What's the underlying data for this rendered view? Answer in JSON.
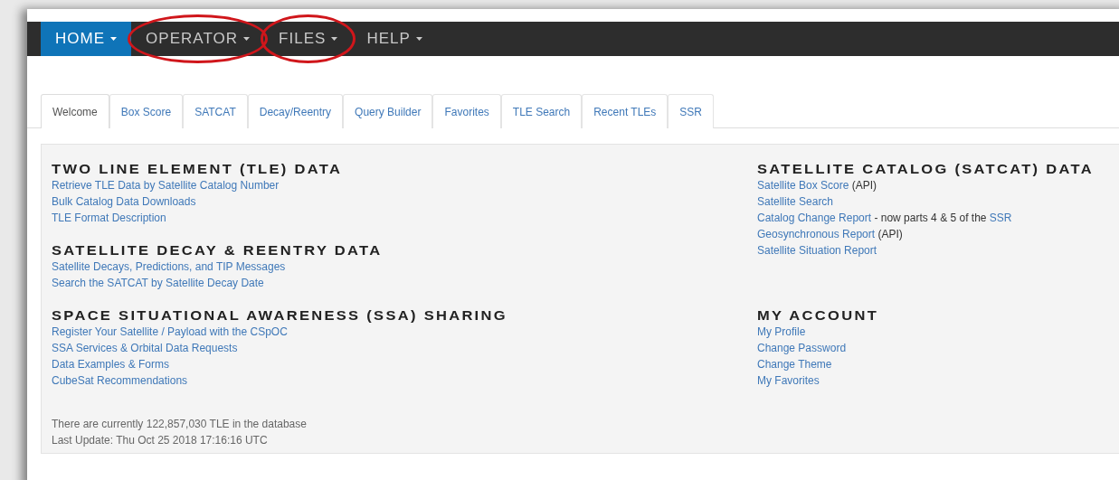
{
  "navbar": [
    {
      "label": "HOME",
      "selected": true,
      "circled": false
    },
    {
      "label": "OPERATOR",
      "selected": false,
      "circled": true
    },
    {
      "label": "FILES",
      "selected": false,
      "circled": true
    },
    {
      "label": "HELP",
      "selected": false,
      "circled": false
    }
  ],
  "tabs": [
    {
      "label": "Welcome",
      "selected": true
    },
    {
      "label": "Box Score",
      "selected": false
    },
    {
      "label": "SATCAT",
      "selected": false
    },
    {
      "label": "Decay/Reentry",
      "selected": false
    },
    {
      "label": "Query Builder",
      "selected": false
    },
    {
      "label": "Favorites",
      "selected": false
    },
    {
      "label": "TLE Search",
      "selected": false
    },
    {
      "label": "Recent TLEs",
      "selected": false
    },
    {
      "label": "SSR",
      "selected": false
    }
  ],
  "left_sections": [
    {
      "title": "TWO LINE ELEMENT (TLE) DATA",
      "lines": [
        [
          {
            "text": "Retrieve TLE Data by Satellite Catalog Number",
            "link": true
          }
        ],
        [
          {
            "text": "Bulk Catalog Data Downloads",
            "link": true
          }
        ],
        [
          {
            "text": "TLE Format Description",
            "link": true
          }
        ]
      ]
    },
    {
      "title": "SATELLITE DECAY & REENTRY DATA",
      "lines": [
        [
          {
            "text": "Satellite Decays, Predictions, and TIP Messages",
            "link": true
          }
        ],
        [
          {
            "text": "Search the SATCAT by Satellite Decay Date",
            "link": true
          }
        ]
      ]
    },
    {
      "title": "SPACE SITUATIONAL AWARENESS (SSA) SHARING",
      "lines": [
        [
          {
            "text": "Register Your Satellite / Payload with the CSpOC",
            "link": true
          }
        ],
        [
          {
            "text": "SSA Services & Orbital Data Requests",
            "link": true
          }
        ],
        [
          {
            "text": "Data Examples & Forms",
            "link": true
          }
        ],
        [
          {
            "text": "CubeSat Recommendations",
            "link": true
          }
        ]
      ]
    }
  ],
  "right_sections": [
    {
      "title": "SATELLITE CATALOG (SATCAT) DATA",
      "lines": [
        [
          {
            "text": "Satellite Box Score",
            "link": true
          },
          {
            "text": " (API)",
            "link": false
          }
        ],
        [
          {
            "text": "Satellite Search",
            "link": true
          }
        ],
        [
          {
            "text": "Catalog Change Report",
            "link": true
          },
          {
            "text": " - now parts 4 & 5 of the ",
            "link": false
          },
          {
            "text": "SSR",
            "link": true
          }
        ],
        [
          {
            "text": "Geosynchronous Report",
            "link": true
          },
          {
            "text": " (API)",
            "link": false
          }
        ],
        [
          {
            "text": "Satellite Situation Report",
            "link": true
          }
        ]
      ]
    },
    {
      "title": "MY ACCOUNT",
      "lines": [
        [
          {
            "text": "My Profile",
            "link": true
          }
        ],
        [
          {
            "text": "Change Password",
            "link": true
          }
        ],
        [
          {
            "text": "Change Theme",
            "link": true
          }
        ],
        [
          {
            "text": "My Favorites",
            "link": true
          }
        ]
      ]
    }
  ],
  "footer": [
    "There are currently 122,857,030 TLE in the database",
    "Last Update: Thu Oct 25 2018 17:16:16 UTC"
  ]
}
